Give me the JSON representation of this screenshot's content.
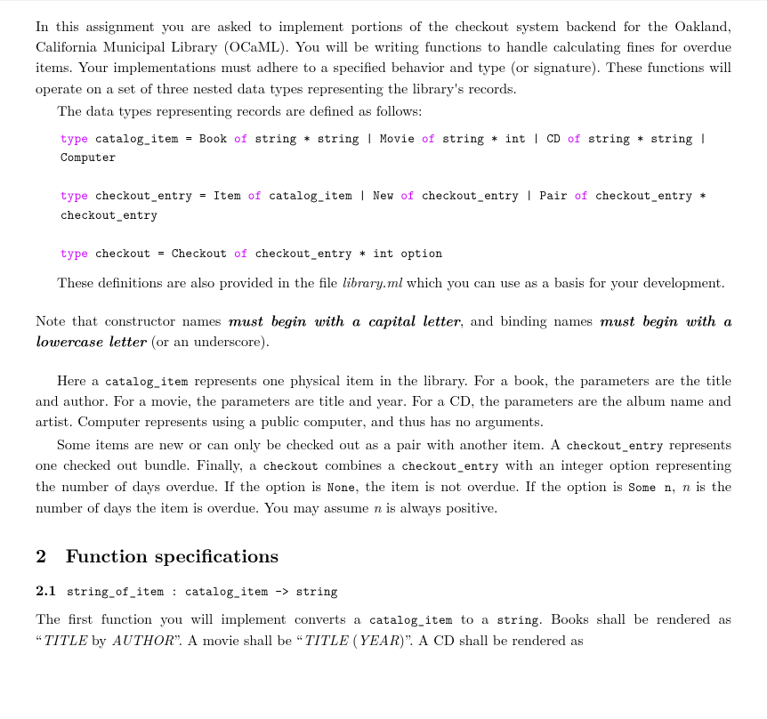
{
  "intro_p1": "In this assignment you are asked to implement portions of the checkout system backend for the Oakland, California Municipal Library (OCaML). You will be writing functions to handle calculating fines for overdue items. Your implementations must adhere to a specified behavior and type (or signature). These functions will operate on a set of three nested data types representing the library's records.",
  "intro_p2": "The data types representing records are defined as follows:",
  "t": {
    "type": "type",
    "of": "of",
    "catalog_item_eq": " catalog_item = Book ",
    "ci_ss_mov": " string * string | Movie ",
    "ci_si_cd": " string * int | CD ",
    "ci_ss_comp": " string * string | Computer",
    "ce_eq": " checkout_entry = Item ",
    "ce_ci_new": " catalog_item | New ",
    "ce_ce_pair": " checkout_entry | Pair ",
    "ce_pair_ty": " checkout_entry * checkout_entry",
    "co_eq": " checkout = Checkout ",
    "co_ty": " checkout_entry * int option"
  },
  "after_defs_pre": "These definitions are also provided in the file ",
  "library_file": "library.ml",
  "after_defs_post": " which you can use as a basis for your development.",
  "note_pre": "Note that constructor names ",
  "note_emph1": "must begin with a capital letter",
  "note_mid1": ", and binding names ",
  "note_emph2": "must begin with a lowercase letter",
  "note_post": " (or an underscore).",
  "explain1_a": "Here a ",
  "explain1_ci": "catalog_item",
  "explain1_b": " represents one physical item in the library. For a book, the parameters are the title and author. For a movie, the parameters are title and year. For a CD, the parameters are the album name and artist. Computer represents using a public computer, and thus has no arguments.",
  "explain2_a": "Some items are new or can only be checked out as a pair with another item. A ",
  "explain2_ce": "checkout_entry",
  "explain2_b": " represents one checked out bundle. Finally, a ",
  "explain2_co": "checkout",
  "explain2_c": " combines a ",
  "explain2_ce2": "checkout_entry",
  "explain2_d": " with an integer option representing the number of days overdue. If the option is ",
  "explain2_none": "None",
  "explain2_e": ", the item is not overdue. If the option is ",
  "explain2_some": "Some n",
  "explain2_f": ", ",
  "explain2_n": "n",
  "explain2_g": " is the number of days the item is overdue. You may assume ",
  "explain2_n2": "n",
  "explain2_h": " is always positive.",
  "sec2_num": "2",
  "sec2_title": "Function specifications",
  "sub21_num": "2.1",
  "sub21_sig": "string_of_item : catalog_item -> string",
  "fun1_a": "The first function you will implement converts a ",
  "fun1_ci": "catalog_item",
  "fun1_b": " to a ",
  "fun1_str": "string",
  "fun1_c": ". Books shall be rendered as “",
  "fun1_title": "TITLE",
  "fun1_by": " by ",
  "fun1_author": "AUTHOR",
  "fun1_d": "”. A movie shall be “",
  "fun1_title2": "TITLE",
  "fun1_sp": " (",
  "fun1_year": "YEAR",
  "fun1_cp": ")",
  "fun1_e": "”. A CD shall be rendered as"
}
